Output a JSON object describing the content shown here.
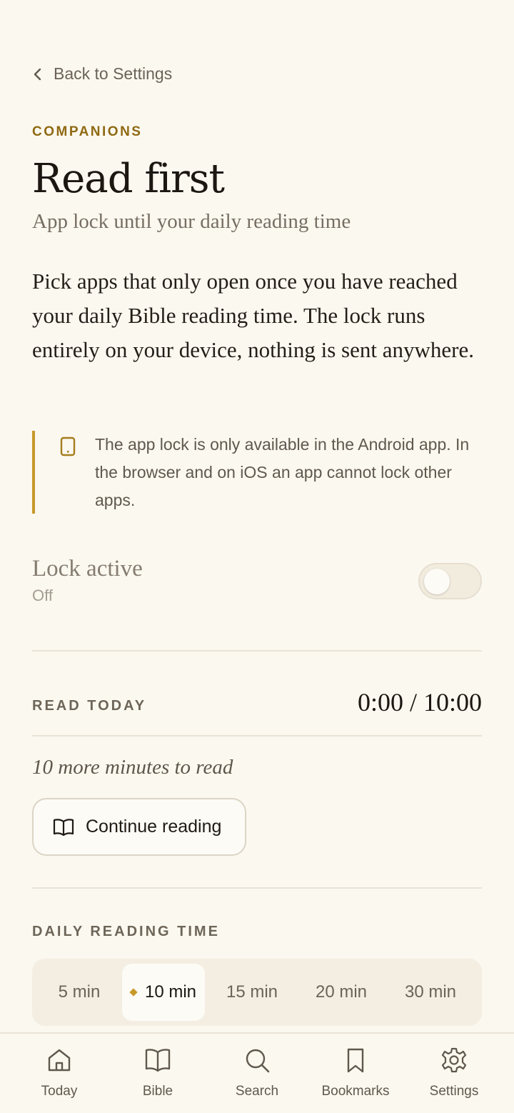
{
  "header": {
    "back_label": "Back to Settings",
    "eyebrow": "COMPANIONS",
    "title": "Read first",
    "subtitle": "App lock until your daily reading time"
  },
  "intro": "Pick apps that only open once you have reached your daily Bible reading time. The lock runs entirely on your device, nothing is sent anywhere.",
  "notice": {
    "icon": "phone-icon",
    "text": "The app lock is only available in the Android app. In the browser and on iOS an app cannot lock other apps."
  },
  "lock": {
    "label": "Lock active",
    "state": "Off",
    "enabled": false
  },
  "read_today": {
    "label": "READ TODAY",
    "value": "0:00 / 10:00",
    "remaining": "10 more minutes to read",
    "continue_label": "Continue reading"
  },
  "daily_time": {
    "label": "DAILY READING TIME",
    "options": [
      "5 min",
      "10 min",
      "15 min",
      "20 min",
      "30 min"
    ],
    "selected": "10 min"
  },
  "nav": {
    "items": [
      {
        "label": "Today",
        "icon": "home-icon"
      },
      {
        "label": "Bible",
        "icon": "book-icon"
      },
      {
        "label": "Search",
        "icon": "search-icon"
      },
      {
        "label": "Bookmarks",
        "icon": "bookmark-icon"
      },
      {
        "label": "Settings",
        "icon": "gear-icon"
      }
    ]
  },
  "colors": {
    "background": "#fbf8f0",
    "accent": "#c79a2b",
    "eyebrow": "#8f6a12",
    "text": "#1c1711"
  }
}
